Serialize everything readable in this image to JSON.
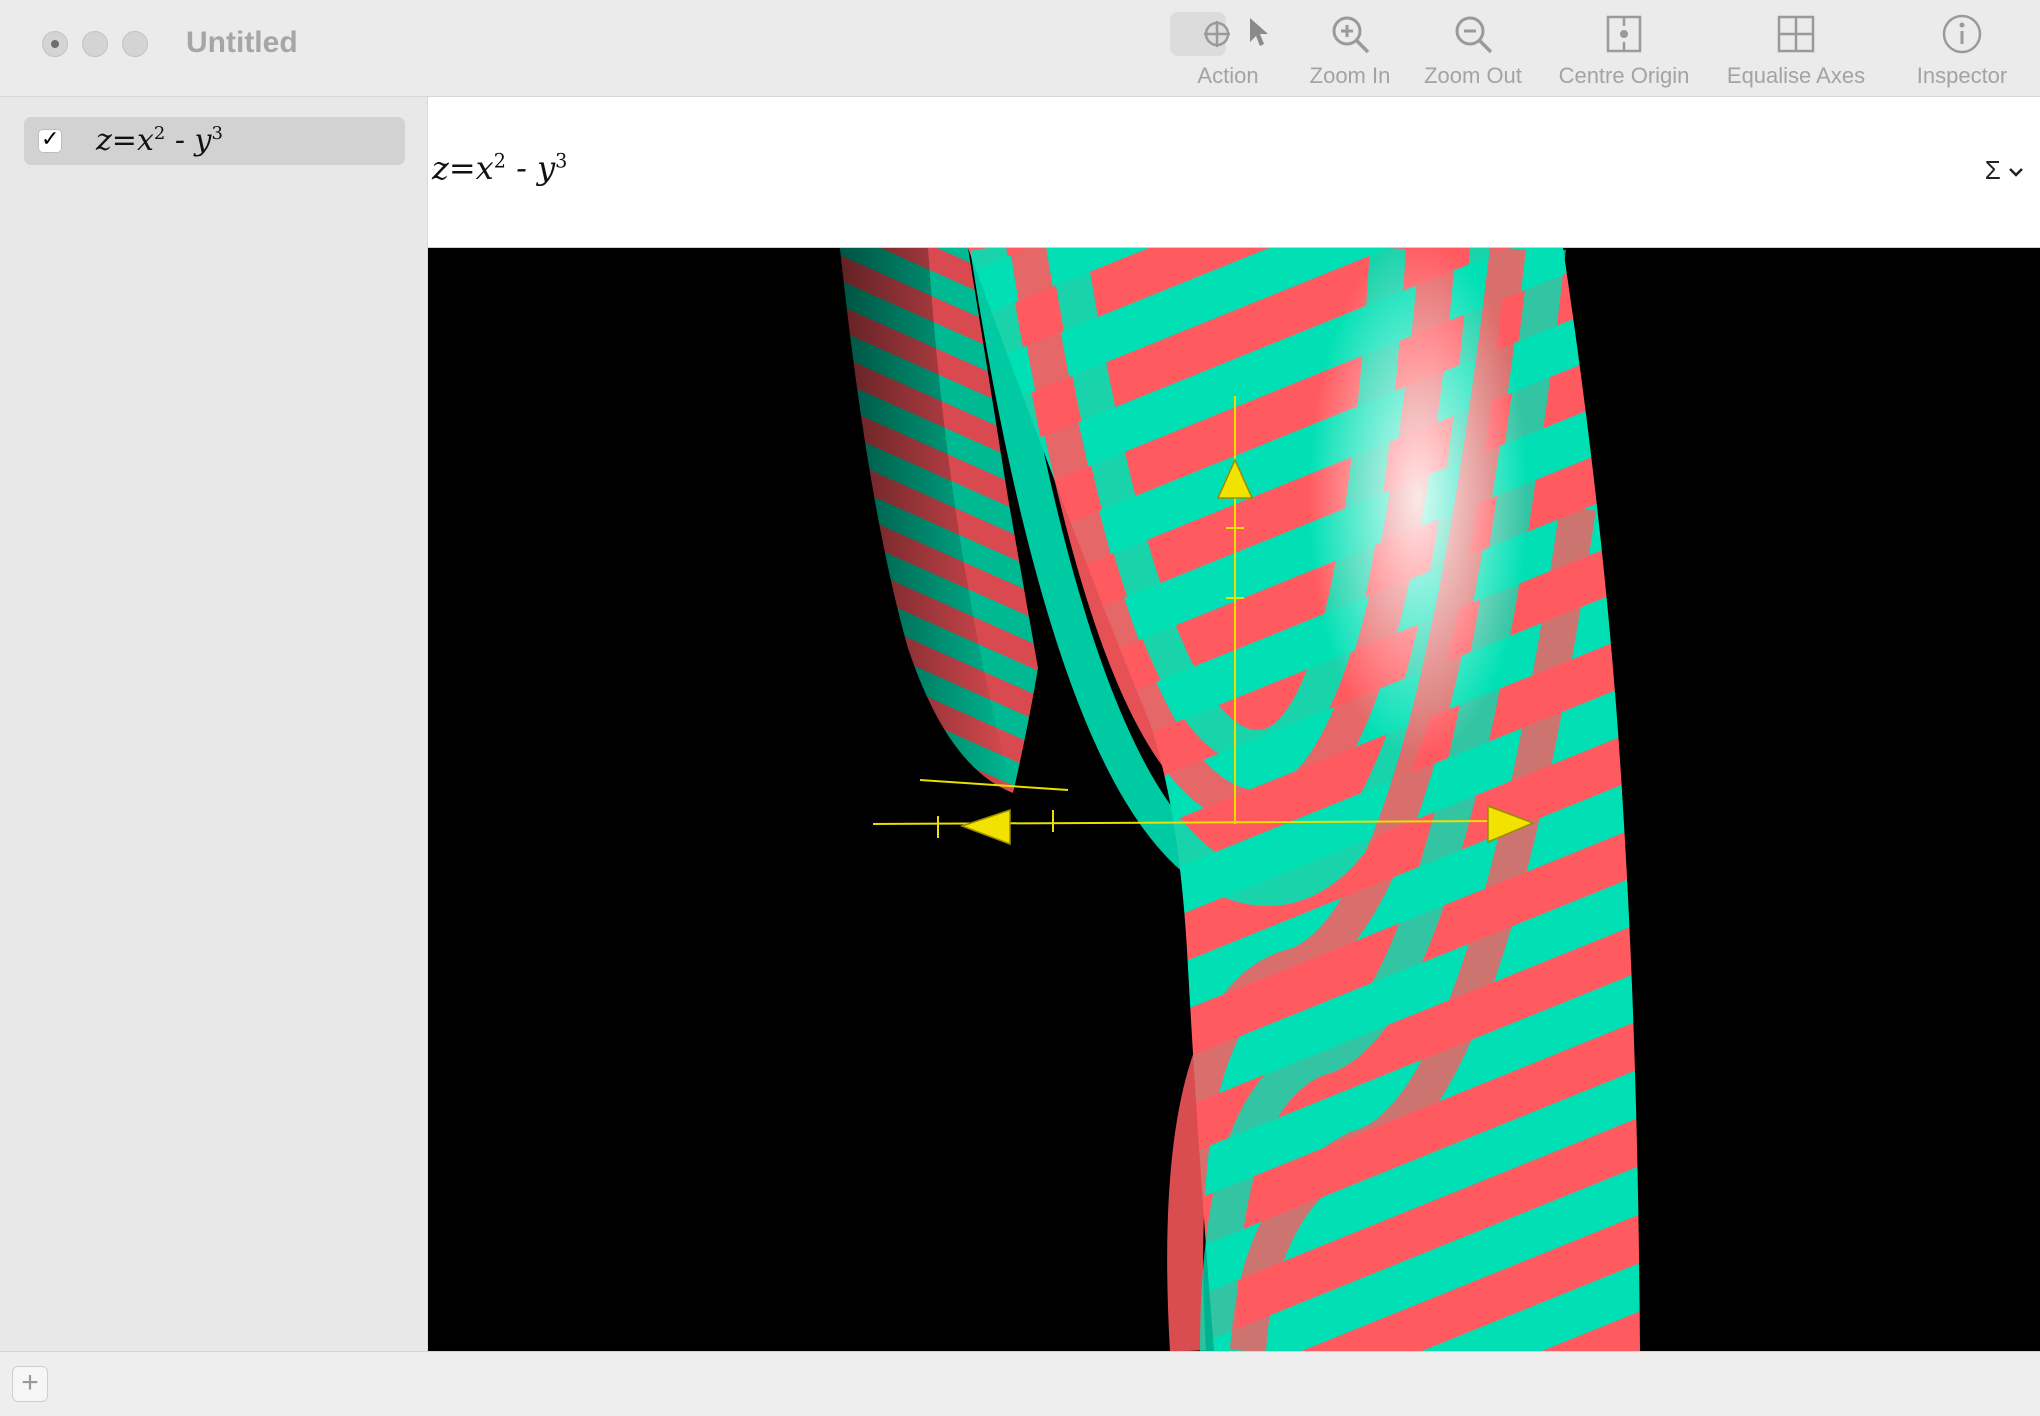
{
  "window": {
    "title": "Untitled"
  },
  "toolbar": {
    "items": [
      {
        "label": "Action",
        "icon": "crosshair-icon"
      },
      {
        "label": "Zoom In",
        "icon": "zoom-in-icon"
      },
      {
        "label": "Zoom Out",
        "icon": "zoom-out-icon"
      },
      {
        "label": "Centre Origin",
        "icon": "centre-origin-icon"
      },
      {
        "label": "Equalise Axes",
        "icon": "equalise-axes-icon"
      },
      {
        "label": "Inspector",
        "icon": "info-icon"
      }
    ]
  },
  "sidebar": {
    "equations": [
      {
        "checked": true,
        "lhs": "z=x",
        "exp1": "2",
        "mid": " - y",
        "exp2": "3"
      }
    ]
  },
  "editor": {
    "lhs": "z=x",
    "exp1": "2",
    "mid": " - y",
    "exp2": "3",
    "sigma": "Σ"
  },
  "plot": {
    "surface_colors": [
      "#ff5a5f",
      "#00e0b4"
    ],
    "axis_color": "#e8e000",
    "background": "#000000"
  },
  "bottombar": {
    "add_label": "+"
  }
}
